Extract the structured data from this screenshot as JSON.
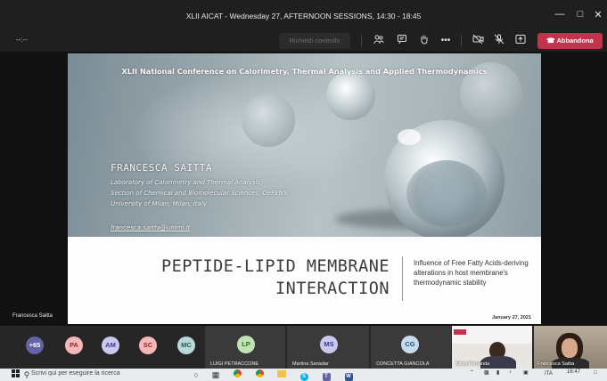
{
  "window": {
    "title": "XLII AICAT - Wednesday 27, AFTERNOON SESSIONS, 14:30 - 18:45",
    "minimize_icon": "minimize-icon",
    "maximize_icon": "maximize-icon",
    "close_icon": "close-icon"
  },
  "toolbar": {
    "timer": "--:--",
    "request_control_label": "Richiedi controllo",
    "leave_label": "Abbandona",
    "icons": [
      "participants-icon",
      "chat-icon",
      "raise-hand-icon",
      "more-icon",
      "camera-off-icon",
      "mic-off-icon",
      "share-icon",
      "hangup-icon"
    ]
  },
  "slide": {
    "conference_title": "XLII National Conference on Calorimetry, Thermal Analysis and Applied Thermodynamics",
    "speaker_name": "FRANCESCA SAITTA",
    "affiliation": [
      "Laboratory of Calorimetry and Thermal Analysis,",
      "Section of Chemical and Biomolecular Sciences, DeFENS,",
      "University of Milan, Milan, Italy"
    ],
    "email": "francesca.saitta@unimi.it",
    "title_line1": "PEPTIDE-LIPID MEMBRANE",
    "title_line2": "INTERACTION",
    "subtitle": "Influence of Free Fatty Acids-deriving alterations in host membrane's thermodynamic stability",
    "date": "January 27, 2021"
  },
  "stage": {
    "presenter_name": "Francesca Saitta"
  },
  "participants": {
    "more_count": "+65",
    "avatars": [
      {
        "initials": "PA",
        "bg": "#f4b8b8",
        "fg": "#8a2a2a"
      },
      {
        "initials": "AM",
        "bg": "#c9c8ef",
        "fg": "#3d3a8c"
      },
      {
        "initials": "SC",
        "bg": "#f4b8b8",
        "fg": "#8a2a2a"
      },
      {
        "initials": "MC",
        "bg": "#b9d8d7",
        "fg": "#245c5a"
      }
    ],
    "tiles": [
      {
        "initials": "LP",
        "name": "LUIGI PETRACCONE",
        "bg": "#bfe3b4",
        "fg": "#2e6a22"
      },
      {
        "initials": "MS",
        "name": "Martina Sanadar",
        "bg": "#c9c8ef",
        "fg": "#3d3a8c"
      },
      {
        "initials": "CG",
        "name": "CONCETTA GIANCOLA",
        "bg": "#c9dcef",
        "fg": "#24507a"
      }
    ],
    "videos": [
      {
        "name": "Silvia Fornanda"
      },
      {
        "name": "Francesca Saitta"
      }
    ]
  },
  "taskbar": {
    "search_placeholder": "Scrivi qui per eseguire la ricerca",
    "language": "ITA",
    "time": "16:47",
    "icons": [
      "windows-start-icon",
      "search-icon",
      "cortana-icon",
      "task-view-icon",
      "chrome-icon",
      "chrome-alt-icon",
      "file-explorer-icon",
      "skype-icon",
      "teams-icon",
      "word-icon"
    ]
  }
}
